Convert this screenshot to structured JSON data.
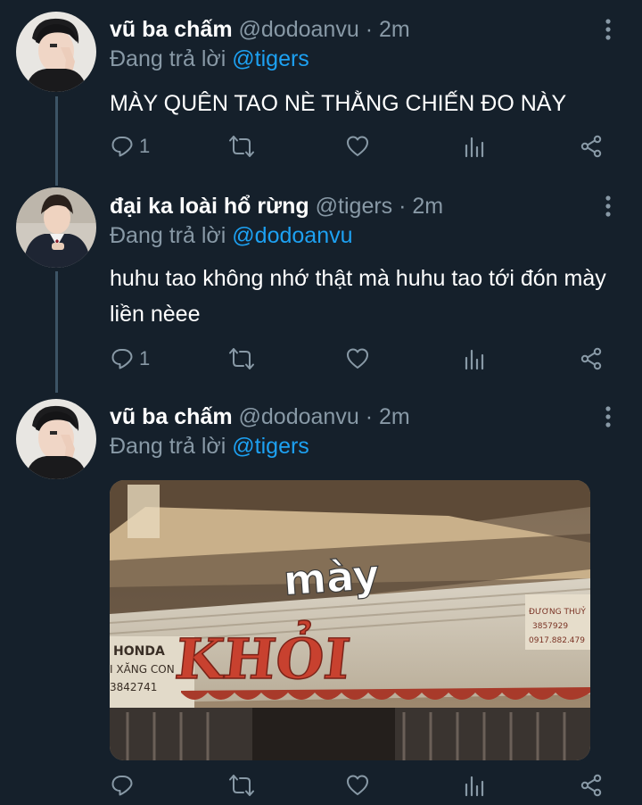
{
  "tweets": [
    {
      "name": "vũ ba chấm",
      "handle": "@dodoanvu",
      "time": "· 2m",
      "reply_label": "Đang trả lời",
      "reply_to": "@tigers",
      "text": "MÀY QUÊN TAO NÈ THẰNG CHIẾN ĐO NÀY",
      "reply_count": "1"
    },
    {
      "name": "đại ka loài hổ rừng",
      "handle": "@tigers",
      "time": "· 2m",
      "reply_label": "Đang trả lời",
      "reply_to": "@dodoanvu",
      "text": "huhu tao không nhớ thật mà huhu tao tới đón mày liền nèee",
      "reply_count": "1"
    },
    {
      "name": "vũ ba chấm",
      "handle": "@dodoanvu",
      "time": "· 2m",
      "reply_label": "Đang trả lời",
      "reply_to": "@tigers",
      "reply_count": ""
    }
  ],
  "media": {
    "caption": "mày",
    "sign_text": "KHỎI",
    "honda_lines": [
      "HONDA",
      "I XĂNG CON",
      "3842741"
    ],
    "sign_right_lines": [
      "ĐƯƠNG THUỶ",
      "3857929",
      "0917.882.479"
    ]
  },
  "colors": {
    "background": "#15202b",
    "text": "#ffffff",
    "muted": "#8899a6",
    "accent": "#1da1f2"
  },
  "icons": [
    "reply-icon",
    "retweet-icon",
    "like-icon",
    "analytics-icon",
    "share-icon",
    "more-icon"
  ]
}
